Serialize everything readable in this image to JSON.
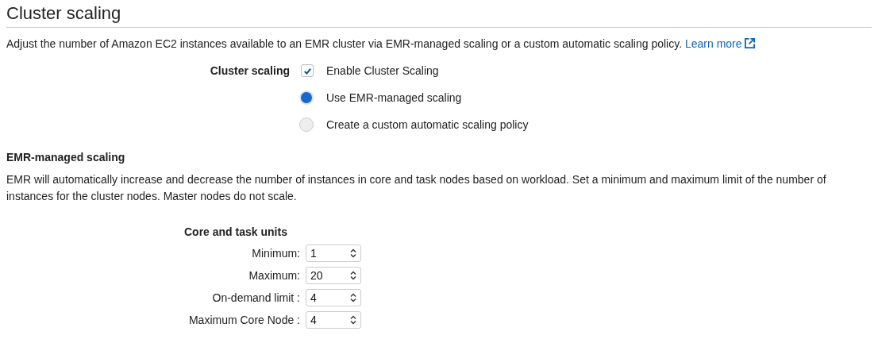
{
  "title": "Cluster scaling",
  "description": "Adjust the number of Amazon EC2 instances available to an EMR cluster via EMR-managed scaling or a custom automatic scaling policy.",
  "learn_more": "Learn more",
  "cluster_scaling": {
    "label": "Cluster scaling",
    "options": [
      {
        "kind": "checkbox",
        "label": "Enable Cluster Scaling",
        "checked": true
      },
      {
        "kind": "radio",
        "label": "Use EMR-managed scaling",
        "selected": true
      },
      {
        "kind": "radio",
        "label": "Create a custom automatic scaling policy",
        "selected": false
      }
    ]
  },
  "managed": {
    "heading": "EMR-managed scaling",
    "text": "EMR will automatically increase and decrease the number of instances in core and task nodes based on workload. Set a minimum and maximum limit of the number of instances for the cluster nodes. Master nodes do not scale.",
    "units_heading": "Core and task units",
    "fields": [
      {
        "label": "Minimum:",
        "value": "1"
      },
      {
        "label": "Maximum:",
        "value": "20"
      },
      {
        "label": "On-demand limit :",
        "value": "4"
      },
      {
        "label": "Maximum Core Node :",
        "value": "4"
      }
    ]
  }
}
